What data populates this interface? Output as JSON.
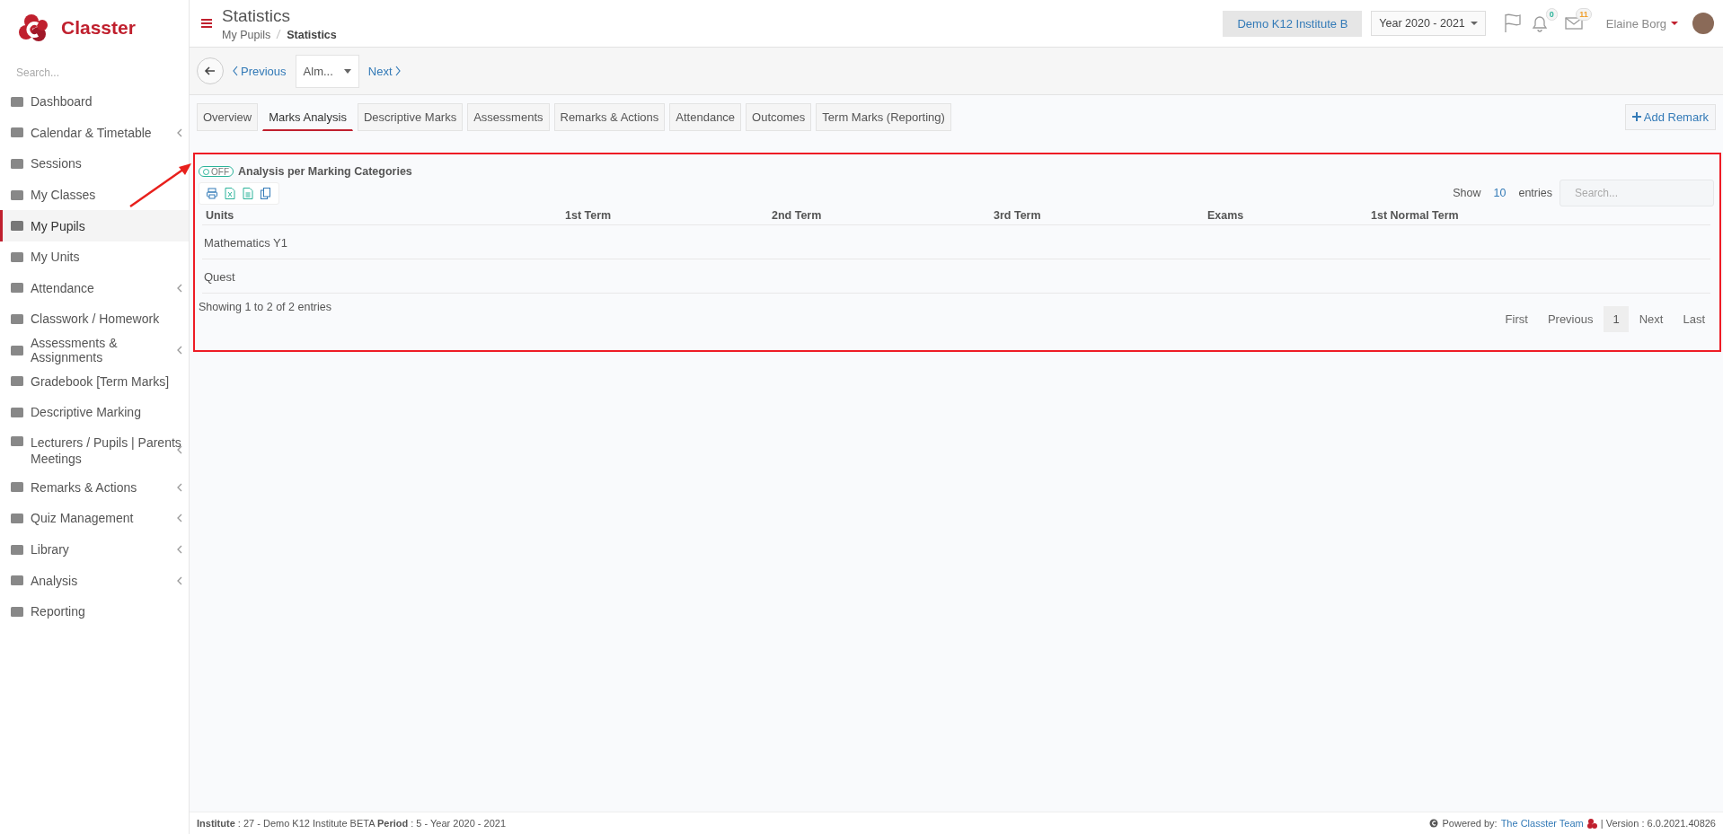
{
  "brand": {
    "name": "Classter"
  },
  "sidebar": {
    "search_placeholder": "Search...",
    "items": [
      {
        "label": "Dashboard",
        "selected": false,
        "expandable": false
      },
      {
        "label": "Calendar & Timetable",
        "selected": false,
        "expandable": true
      },
      {
        "label": "Sessions",
        "selected": false,
        "expandable": false
      },
      {
        "label": "My Classes",
        "selected": false,
        "expandable": false
      },
      {
        "label": "My Pupils",
        "selected": true,
        "expandable": false
      },
      {
        "label": "My Units",
        "selected": false,
        "expandable": false
      },
      {
        "label": "Attendance",
        "selected": false,
        "expandable": true
      },
      {
        "label": "Classwork / Homework",
        "selected": false,
        "expandable": false
      },
      {
        "label": "Assessments & Assignments",
        "selected": false,
        "expandable": true
      },
      {
        "label": "Gradebook [Term Marks]",
        "selected": false,
        "expandable": false
      },
      {
        "label": "Descriptive Marking",
        "selected": false,
        "expandable": false
      },
      {
        "label": "Lecturers / Pupils | Parents Meetings",
        "selected": false,
        "expandable": true
      },
      {
        "label": "Remarks & Actions",
        "selected": false,
        "expandable": true
      },
      {
        "label": "Quiz Management",
        "selected": false,
        "expandable": true
      },
      {
        "label": "Library",
        "selected": false,
        "expandable": true
      },
      {
        "label": "Analysis",
        "selected": false,
        "expandable": true
      },
      {
        "label": "Reporting",
        "selected": false,
        "expandable": false
      }
    ]
  },
  "header": {
    "title": "Statistics",
    "breadcrumb": [
      "My Pupils",
      "Statistics"
    ],
    "institute": "Demo K12 Institute B",
    "year": "Year 2020 - 2021",
    "notifications": "0",
    "messages": "11",
    "user": "Elaine Borg"
  },
  "navigator": {
    "previous": "Previous",
    "current": "Alm...",
    "next": "Next"
  },
  "tabs": [
    {
      "label": "Overview",
      "selected": false
    },
    {
      "label": "Marks Analysis",
      "selected": true
    },
    {
      "label": "Descriptive Marks",
      "selected": false
    },
    {
      "label": "Assessments",
      "selected": false
    },
    {
      "label": "Remarks & Actions",
      "selected": false
    },
    {
      "label": "Attendance",
      "selected": false
    },
    {
      "label": "Outcomes",
      "selected": false
    },
    {
      "label": "Term Marks (Reporting)",
      "selected": false
    }
  ],
  "add_remark": "Add Remark",
  "toggle": {
    "on": false,
    "state_label": "OFF",
    "label": "Analysis per Marking Categories"
  },
  "table": {
    "show_label": "Show",
    "page_size": "10",
    "entries_label": "entries",
    "search_placeholder": "Search...",
    "columns": [
      "Units",
      "1st Term",
      "2nd Term",
      "3rd Term",
      "Exams",
      "1st Normal Term"
    ],
    "rows": [
      {
        "unit": "Mathematics Y1"
      },
      {
        "unit": "Quest"
      }
    ],
    "info": "Showing 1 to 2 of 2 entries",
    "pagination": [
      {
        "label": "First",
        "selected": false
      },
      {
        "label": "Previous",
        "selected": false
      },
      {
        "label": "1",
        "selected": true
      },
      {
        "label": "Next",
        "selected": false
      },
      {
        "label": "Last",
        "selected": false
      }
    ]
  },
  "footer": {
    "details": "**Institute** : 27 - Demo K12 Institute BETA **Period** : 5 - Year 2020 - 2021",
    "powered_by": "Powered by:",
    "team_link": "The Classter Team",
    "version": "| Version : 6.0.2021.40826"
  }
}
